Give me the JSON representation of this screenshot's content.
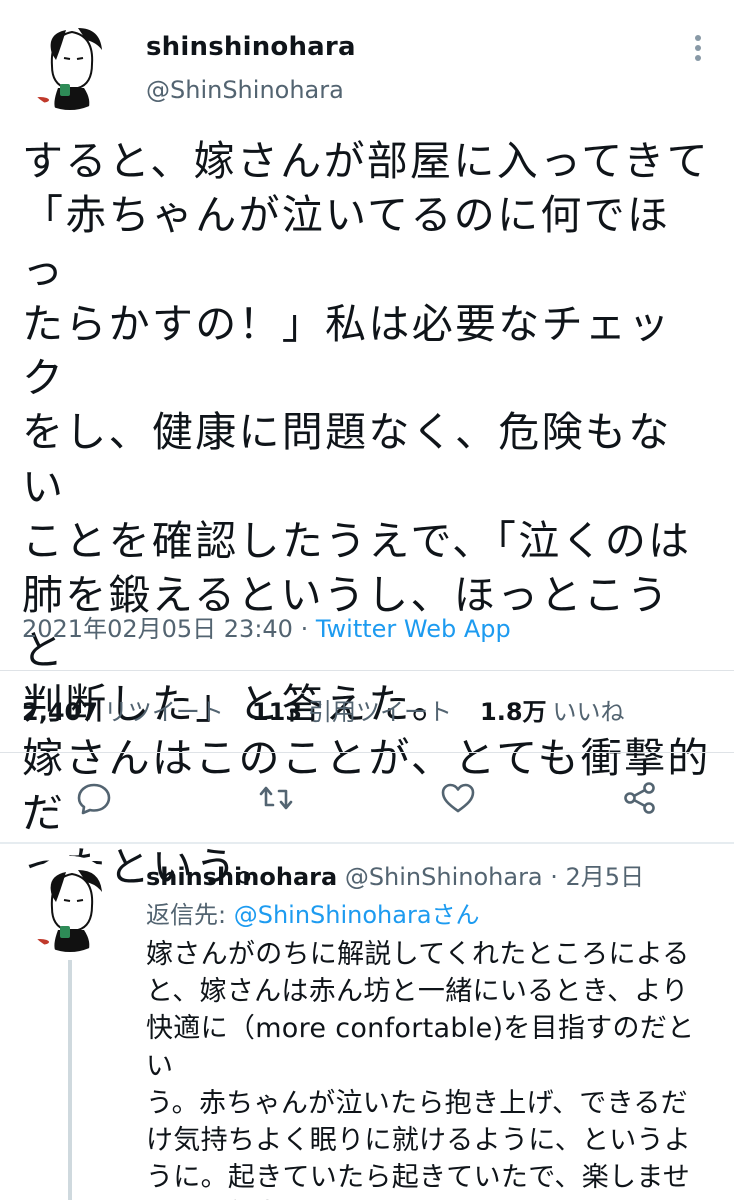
{
  "tweet": {
    "author_name": "shinshinohara",
    "author_handle": "@ShinShinohara",
    "text": "すると、嫁さんが部屋に入ってきて\n「赤ちゃんが泣いてるのに何でほっ\nたらかすの！」私は必要なチェック\nをし、健康に問題なく、危険もない\nことを確認したうえで、「泣くのは\n肺を鍛えるというし、ほっとこうと\n判断した」と答えた。\n嫁さんはこのことが、とても衝撃的だ\nったという。",
    "timestamp": "2021年02月05日 23:40",
    "separator": " · ",
    "source_app": "Twitter Web App",
    "stats": {
      "retweets": "2,407",
      "retweets_label": "リツイート",
      "quotes": "113",
      "quotes_label": "引用ツイート",
      "likes": "1.8万",
      "likes_label": "いいね"
    },
    "icons": {
      "more": "more-dots-icon",
      "reply": "reply-bubble-icon",
      "retweet": "retweet-icon",
      "like": "heart-icon",
      "share": "share-icon"
    }
  },
  "reply": {
    "author_name": "shinshinohara",
    "author_handle": "@ShinShinohara",
    "separator": " · ",
    "date": "2月5日",
    "replying_label": "返信先: ",
    "replying_to": "@ShinShinoharaさん",
    "text": "嫁さんがのちに解説してくれたところによる\nと、嫁さんは赤ん坊と一緒にいるとき、より\n快適に（more confortable)を目指すのだとい\nう。赤ちゃんが泣いたら抱き上げ、できるだ\nけ気持ちよく眠りに就けるように、というよ\nうに。起きていたら起きていたで、楽しませ\nようと努力するのだという。"
  },
  "colors": {
    "text": "#0f1419",
    "secondary": "#536471",
    "link": "#1d9bf0",
    "divider": "#dfe3e7"
  }
}
